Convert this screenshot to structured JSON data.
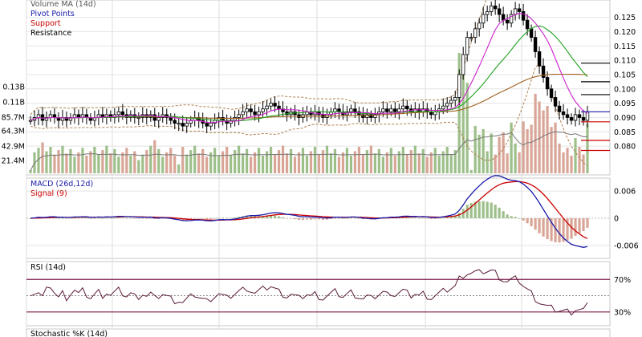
{
  "chart_data": [
    {
      "type": "candlestick",
      "panel": "price",
      "legend": [
        "Volume MA (14d)",
        "Pivot Points",
        "Support",
        "Resistance"
      ],
      "legend_colors": [
        "#555555",
        "#1a1aa8",
        "#cc0000",
        "#000000"
      ],
      "ylim": [
        0.0705,
        0.1305
      ],
      "y_ticks": [
        "0.125",
        "0.120",
        "0.115",
        "0.110",
        "0.105",
        "0.100",
        "0.095",
        "0.090",
        "0.085",
        "0.080"
      ],
      "volume_ticks": [
        "0.13B",
        "0.11B",
        "85.7M",
        "64.3M",
        "42.9M",
        "21.4M"
      ],
      "close": [
        0.089,
        0.09,
        0.091,
        0.089,
        0.09,
        0.091,
        0.09,
        0.089,
        0.09,
        0.089,
        0.09,
        0.091,
        0.09,
        0.091,
        0.09,
        0.089,
        0.09,
        0.091,
        0.09,
        0.091,
        0.09,
        0.091,
        0.092,
        0.091,
        0.09,
        0.091,
        0.09,
        0.09,
        0.091,
        0.09,
        0.091,
        0.089,
        0.09,
        0.091,
        0.09,
        0.089,
        0.088,
        0.088,
        0.087,
        0.088,
        0.089,
        0.09,
        0.089,
        0.088,
        0.087,
        0.088,
        0.089,
        0.09,
        0.089,
        0.088,
        0.089,
        0.09,
        0.091,
        0.092,
        0.093,
        0.092,
        0.091,
        0.092,
        0.093,
        0.094,
        0.095,
        0.094,
        0.093,
        0.092,
        0.091,
        0.092,
        0.091,
        0.09,
        0.091,
        0.092,
        0.091,
        0.092,
        0.091,
        0.09,
        0.091,
        0.092,
        0.093,
        0.092,
        0.091,
        0.092,
        0.093,
        0.092,
        0.091,
        0.09,
        0.091,
        0.09,
        0.091,
        0.092,
        0.093,
        0.092,
        0.093,
        0.092,
        0.093,
        0.094,
        0.093,
        0.092,
        0.093,
        0.092,
        0.093,
        0.092,
        0.091,
        0.092,
        0.093,
        0.094,
        0.095,
        0.096,
        0.097,
        0.105,
        0.112,
        0.118,
        0.118,
        0.121,
        0.123,
        0.126,
        0.127,
        0.129,
        0.128,
        0.126,
        0.124,
        0.123,
        0.126,
        0.128,
        0.127,
        0.124,
        0.121,
        0.118,
        0.113,
        0.108,
        0.104,
        0.1,
        0.097,
        0.094,
        0.092,
        0.091,
        0.09,
        0.089,
        0.091,
        0.09,
        0.089,
        0.092
      ],
      "pivot_levels": [
        {
          "label": "Resistance",
          "value": 0.109
        },
        {
          "label": "Resistance",
          "value": 0.1025
        },
        {
          "label": "Resistance",
          "value": 0.098
        },
        {
          "label": "Pivot Points",
          "value": 0.092
        },
        {
          "label": "Support",
          "value": 0.0885
        },
        {
          "label": "Support",
          "value": 0.082
        },
        {
          "label": "Support",
          "value": 0.0785
        }
      ]
    },
    {
      "type": "macd",
      "panel": "macd",
      "legend": [
        "MACD (26d,12d)",
        "Signal (9)"
      ],
      "legend_colors": [
        "#1a1aa8",
        "#cc0000"
      ],
      "ylim": [
        -0.0085,
        0.0085
      ],
      "y_ticks": [
        "0.006",
        "0",
        "-0.006"
      ]
    },
    {
      "type": "line",
      "panel": "rsi",
      "legend": [
        "RSI (14d)"
      ],
      "legend_colors": [
        "#000000"
      ],
      "ylim": [
        15,
        90
      ],
      "y_ticks": [
        "70%",
        "30%"
      ],
      "levels": [
        70,
        50,
        30
      ]
    },
    {
      "type": "line",
      "panel": "stochastic",
      "legend": [
        "Stochastic %K (14d)"
      ]
    }
  ]
}
